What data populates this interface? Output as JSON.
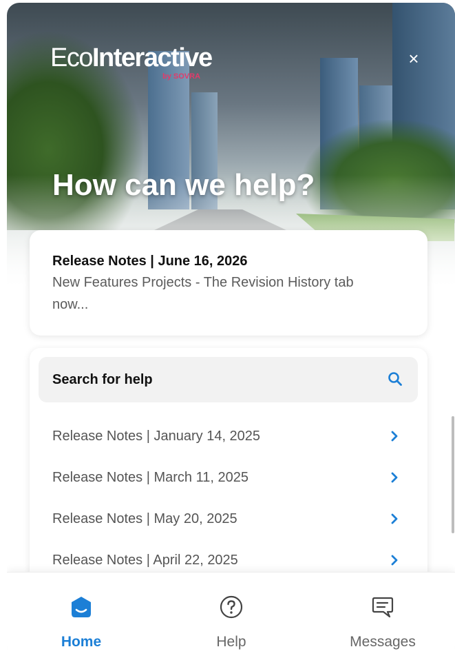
{
  "header": {
    "logo_main_light": "Eco",
    "logo_main_bold": "Interactive",
    "logo_sub": "by SOVRA",
    "close_label": "×",
    "title": "How can we help?"
  },
  "featured": {
    "title": "Release Notes | June 16, 2026",
    "body_line1": "New Features Projects - The Revision History tab",
    "body_line2": "now..."
  },
  "search": {
    "label": "Search for help"
  },
  "articles": [
    {
      "label": "Release Notes | January 14, 2025"
    },
    {
      "label": "Release Notes | March 11, 2025"
    },
    {
      "label": "Release Notes | May 20, 2025"
    },
    {
      "label": "Release Notes | April 22, 2025"
    }
  ],
  "nav": {
    "home": "Home",
    "help": "Help",
    "messages": "Messages"
  },
  "colors": {
    "accent": "#1c7fd6",
    "logo_sub": "#e23a6a"
  },
  "icons": [
    "close-icon",
    "search-icon",
    "chevron-right-icon",
    "home-icon",
    "help-icon",
    "messages-icon"
  ]
}
